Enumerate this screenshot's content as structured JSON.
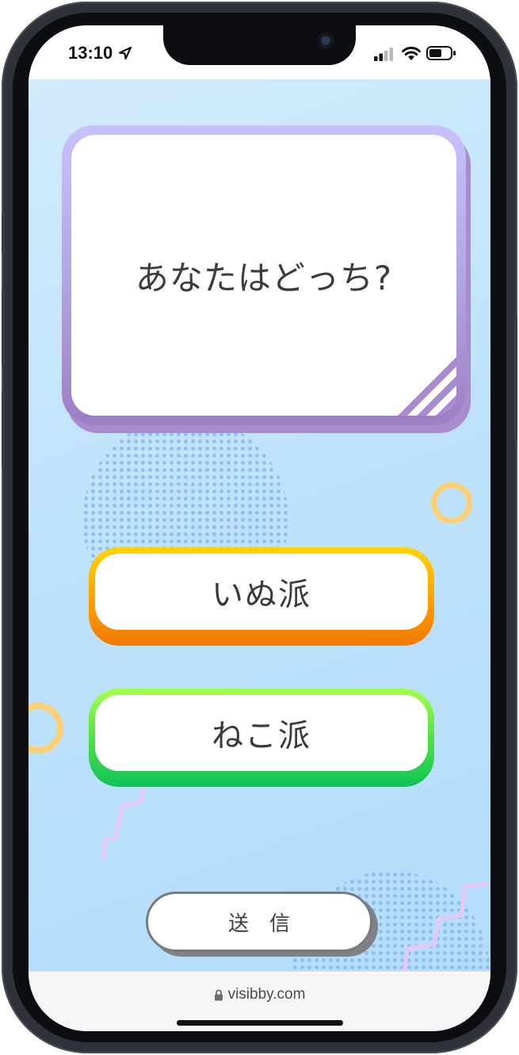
{
  "status_bar": {
    "time": "13:10",
    "icons": [
      "location-arrow-icon",
      "cellular-signal-icon",
      "wifi-icon",
      "battery-icon"
    ]
  },
  "quiz": {
    "question": "あなたはどっち?",
    "options": [
      {
        "label": "いぬ派",
        "accent": "#ff9a00"
      },
      {
        "label": "ねこ派",
        "accent": "#35d14c"
      }
    ],
    "submit_label": "送信"
  },
  "browser": {
    "url": "visibby.com",
    "secure_icon": "lock-icon"
  },
  "colors": {
    "background": "#bfe3fb",
    "card_frame": "#b2a6e6",
    "dog_option": "#ff9a00",
    "cat_option": "#35d14c",
    "deco_ring": "#ffd072",
    "deco_dots": "#8ab8f0",
    "deco_zigzag": "#e7c8f4"
  }
}
